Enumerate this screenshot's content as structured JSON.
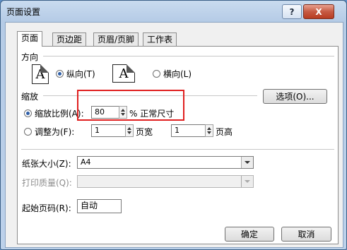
{
  "window": {
    "title": "页面设置",
    "help_label": "?",
    "close_label": "X"
  },
  "tabs": [
    {
      "label": "页面",
      "active": true
    },
    {
      "label": "页边距",
      "active": false
    },
    {
      "label": "页眉/页脚",
      "active": false
    },
    {
      "label": "工作表",
      "active": false
    }
  ],
  "orientation": {
    "heading": "方向",
    "portrait_label": "纵向(T)",
    "landscape_label": "横向(L)",
    "icon_glyph": "A",
    "selected": "portrait"
  },
  "scaling": {
    "heading": "缩放",
    "adjust_label": "缩放比例(A):",
    "adjust_value": "80",
    "adjust_suffix": "% 正常尺寸",
    "fit_label": "调整为(F):",
    "pages_wide_value": "1",
    "pages_wide_label": "页宽",
    "pages_tall_value": "1",
    "pages_tall_label": "页高",
    "selected": "adjust"
  },
  "options_button": "选项(O)...",
  "paper_size": {
    "label": "纸张大小(Z):",
    "value": "A4"
  },
  "print_quality": {
    "label": "打印质量(Q):",
    "value": ""
  },
  "first_page": {
    "label": "起始页码(R):",
    "value": "自动"
  },
  "buttons": {
    "ok": "确定",
    "cancel": "取消"
  },
  "colors": {
    "highlight": "#e02020",
    "titlebar": "#b5cbe6",
    "close": "#c65a43",
    "radio_dot": "#2f5fa8"
  }
}
